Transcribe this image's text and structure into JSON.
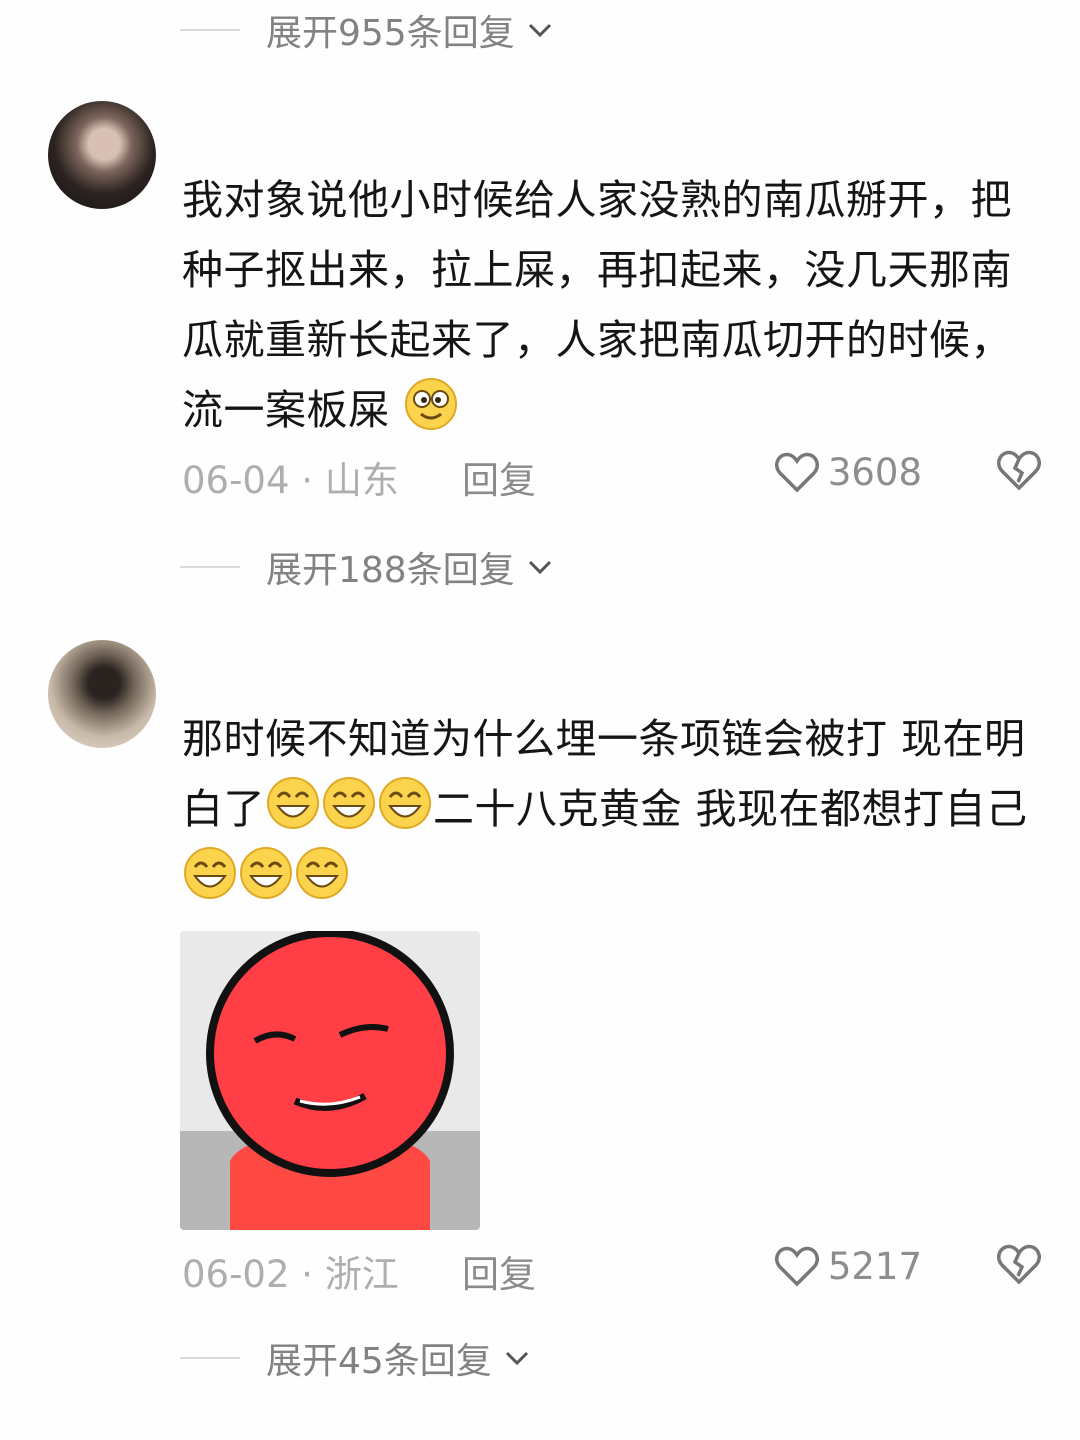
{
  "thread_1": {
    "expand_label": "展开955条回复"
  },
  "comment_1": {
    "text": "我对象说他小时候给人家没熟的南瓜掰开，把种子抠出来，拉上屎，再扣起来，没几天那南瓜就重新长起来了，人家把南瓜切开的时候，流一案板屎",
    "date": "06-04",
    "location": "山东",
    "reply_label": "回复",
    "likes": "3608",
    "expand_label": "展开188条回复"
  },
  "comment_2": {
    "text_part1": "那时候不知道为什么埋一条项链会被打 现在明白了",
    "text_part2": "二十八克黄金 我现在都想打自己",
    "date": "06-02",
    "location": "浙江",
    "reply_label": "回复",
    "likes": "5217",
    "expand_label": "展开45条回复"
  },
  "colors": {
    "secondary_text": "#828282",
    "muted_text": "#aeaeae",
    "primary_text": "#151515"
  },
  "icons": [
    "chevron-down-icon",
    "heart-icon",
    "broken-heart-icon",
    "laughing-emoji",
    "goofy-emoji"
  ]
}
